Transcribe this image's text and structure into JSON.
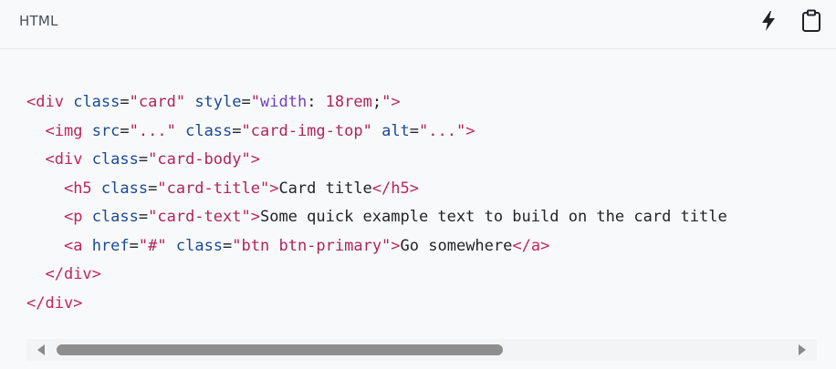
{
  "header": {
    "language_label": "HTML",
    "icons": {
      "run": "lightning-icon",
      "copy": "clipboard-icon"
    }
  },
  "code": {
    "lines": [
      [
        {
          "t": "tag",
          "v": "<div"
        },
        {
          "t": "txt",
          "v": " "
        },
        {
          "t": "attr",
          "v": "class"
        },
        {
          "t": "txt",
          "v": "="
        },
        {
          "t": "str",
          "v": "\"card\""
        },
        {
          "t": "txt",
          "v": " "
        },
        {
          "t": "attr",
          "v": "style"
        },
        {
          "t": "txt",
          "v": "="
        },
        {
          "t": "str",
          "v": "\""
        },
        {
          "t": "prop",
          "v": "width"
        },
        {
          "t": "txt",
          "v": ": "
        },
        {
          "t": "str",
          "v": "18rem"
        },
        {
          "t": "txt",
          "v": ";"
        },
        {
          "t": "str",
          "v": "\""
        },
        {
          "t": "tag",
          "v": ">"
        }
      ],
      [
        {
          "t": "txt",
          "v": "  "
        },
        {
          "t": "tag",
          "v": "<img"
        },
        {
          "t": "txt",
          "v": " "
        },
        {
          "t": "attr",
          "v": "src"
        },
        {
          "t": "txt",
          "v": "="
        },
        {
          "t": "str",
          "v": "\"...\""
        },
        {
          "t": "txt",
          "v": " "
        },
        {
          "t": "attr",
          "v": "class"
        },
        {
          "t": "txt",
          "v": "="
        },
        {
          "t": "str",
          "v": "\"card-img-top\""
        },
        {
          "t": "txt",
          "v": " "
        },
        {
          "t": "attr",
          "v": "alt"
        },
        {
          "t": "txt",
          "v": "="
        },
        {
          "t": "str",
          "v": "\"...\""
        },
        {
          "t": "tag",
          "v": ">"
        }
      ],
      [
        {
          "t": "txt",
          "v": "  "
        },
        {
          "t": "tag",
          "v": "<div"
        },
        {
          "t": "txt",
          "v": " "
        },
        {
          "t": "attr",
          "v": "class"
        },
        {
          "t": "txt",
          "v": "="
        },
        {
          "t": "str",
          "v": "\"card-body\""
        },
        {
          "t": "tag",
          "v": ">"
        }
      ],
      [
        {
          "t": "txt",
          "v": "    "
        },
        {
          "t": "tag",
          "v": "<h5"
        },
        {
          "t": "txt",
          "v": " "
        },
        {
          "t": "attr",
          "v": "class"
        },
        {
          "t": "txt",
          "v": "="
        },
        {
          "t": "str",
          "v": "\"card-title\""
        },
        {
          "t": "tag",
          "v": ">"
        },
        {
          "t": "txt",
          "v": "Card title"
        },
        {
          "t": "tag",
          "v": "</h5>"
        }
      ],
      [
        {
          "t": "txt",
          "v": "    "
        },
        {
          "t": "tag",
          "v": "<p"
        },
        {
          "t": "txt",
          "v": " "
        },
        {
          "t": "attr",
          "v": "class"
        },
        {
          "t": "txt",
          "v": "="
        },
        {
          "t": "str",
          "v": "\"card-text\""
        },
        {
          "t": "tag",
          "v": ">"
        },
        {
          "t": "txt",
          "v": "Some quick example text to build on the card title"
        }
      ],
      [
        {
          "t": "txt",
          "v": "    "
        },
        {
          "t": "tag",
          "v": "<a"
        },
        {
          "t": "txt",
          "v": " "
        },
        {
          "t": "attr",
          "v": "href"
        },
        {
          "t": "txt",
          "v": "="
        },
        {
          "t": "str",
          "v": "\"#\""
        },
        {
          "t": "txt",
          "v": " "
        },
        {
          "t": "attr",
          "v": "class"
        },
        {
          "t": "txt",
          "v": "="
        },
        {
          "t": "str",
          "v": "\"btn btn-primary\""
        },
        {
          "t": "tag",
          "v": ">"
        },
        {
          "t": "txt",
          "v": "Go somewhere"
        },
        {
          "t": "tag",
          "v": "</a>"
        }
      ],
      [
        {
          "t": "txt",
          "v": "  "
        },
        {
          "t": "tag",
          "v": "</div>"
        }
      ],
      [
        {
          "t": "tag",
          "v": "</div>"
        }
      ]
    ]
  },
  "scrollbar": {
    "icons": {
      "left": "scroll-left-arrow-icon",
      "right": "scroll-right-arrow-icon"
    }
  },
  "colors": {
    "background": "#f8f9fa",
    "tag": "#c0265a",
    "attribute": "#1c4a94",
    "string": "#b0245c",
    "css_property": "#6f42c1",
    "text": "#212529"
  }
}
